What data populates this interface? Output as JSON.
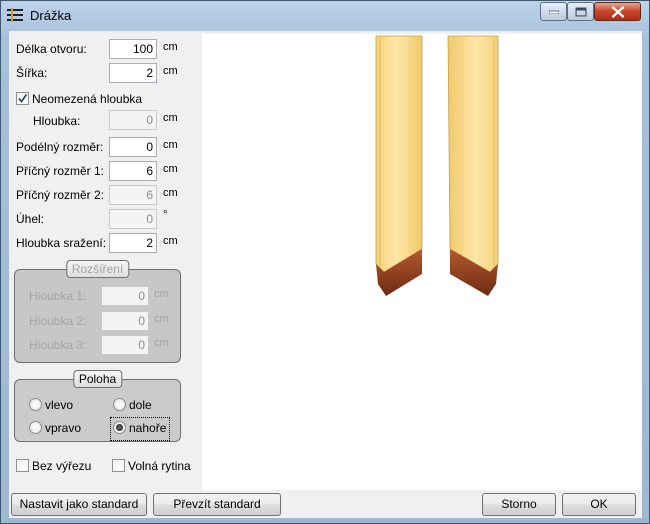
{
  "window": {
    "title": "Drážka"
  },
  "fields": {
    "delka": {
      "label": "Délka otvoru:",
      "value": "100",
      "unit": "cm"
    },
    "sirka": {
      "label": "Šířka:",
      "value": "2",
      "unit": "cm"
    },
    "neomezena": {
      "label": "Neomezená hloubka",
      "checked": true
    },
    "hloubka": {
      "label": "Hloubka:",
      "value": "0",
      "unit": "cm",
      "enabled": false
    },
    "podelny": {
      "label": "Podélný rozměr:",
      "value": "0",
      "unit": "cm"
    },
    "pricny1": {
      "label": "Příčný rozměr 1:",
      "value": "6",
      "unit": "cm"
    },
    "pricny2": {
      "label": "Příčný rozměr 2:",
      "value": "6",
      "unit": "cm",
      "enabled": false
    },
    "uhel": {
      "label": "Úhel:",
      "value": "0",
      "unit": "°",
      "enabled": false
    },
    "srazeni": {
      "label": "Hloubka sražení:",
      "value": "2",
      "unit": "cm"
    }
  },
  "rozsireni": {
    "title": "Rozšíření",
    "enabled": false,
    "rows": [
      {
        "label": "Hloubka 1:",
        "value": "0",
        "unit": "cm"
      },
      {
        "label": "Hloubka 2:",
        "value": "0",
        "unit": "cm"
      },
      {
        "label": "Hloubka 3:",
        "value": "0",
        "unit": "cm"
      }
    ]
  },
  "poloha": {
    "title": "Poloha",
    "options": {
      "vlevo": "vlevo",
      "dole": "dole",
      "vpravo": "vpravo",
      "nahore": "nahoře"
    },
    "selected": "nahoře"
  },
  "checkboxes": {
    "bez_vyrezu": {
      "label": "Bez výřezu",
      "checked": false
    },
    "volna_rytina": {
      "label": "Volná rytina",
      "checked": false
    }
  },
  "buttons": {
    "nastavit": "Nastavit jako standard",
    "prevzit": "Převzít standard",
    "storno": "Storno",
    "ok": "OK"
  },
  "colors": {
    "wood_light": "#fbe3a3",
    "wood_mid": "#f2cf72",
    "wood_cut": "#8a3b1f"
  }
}
